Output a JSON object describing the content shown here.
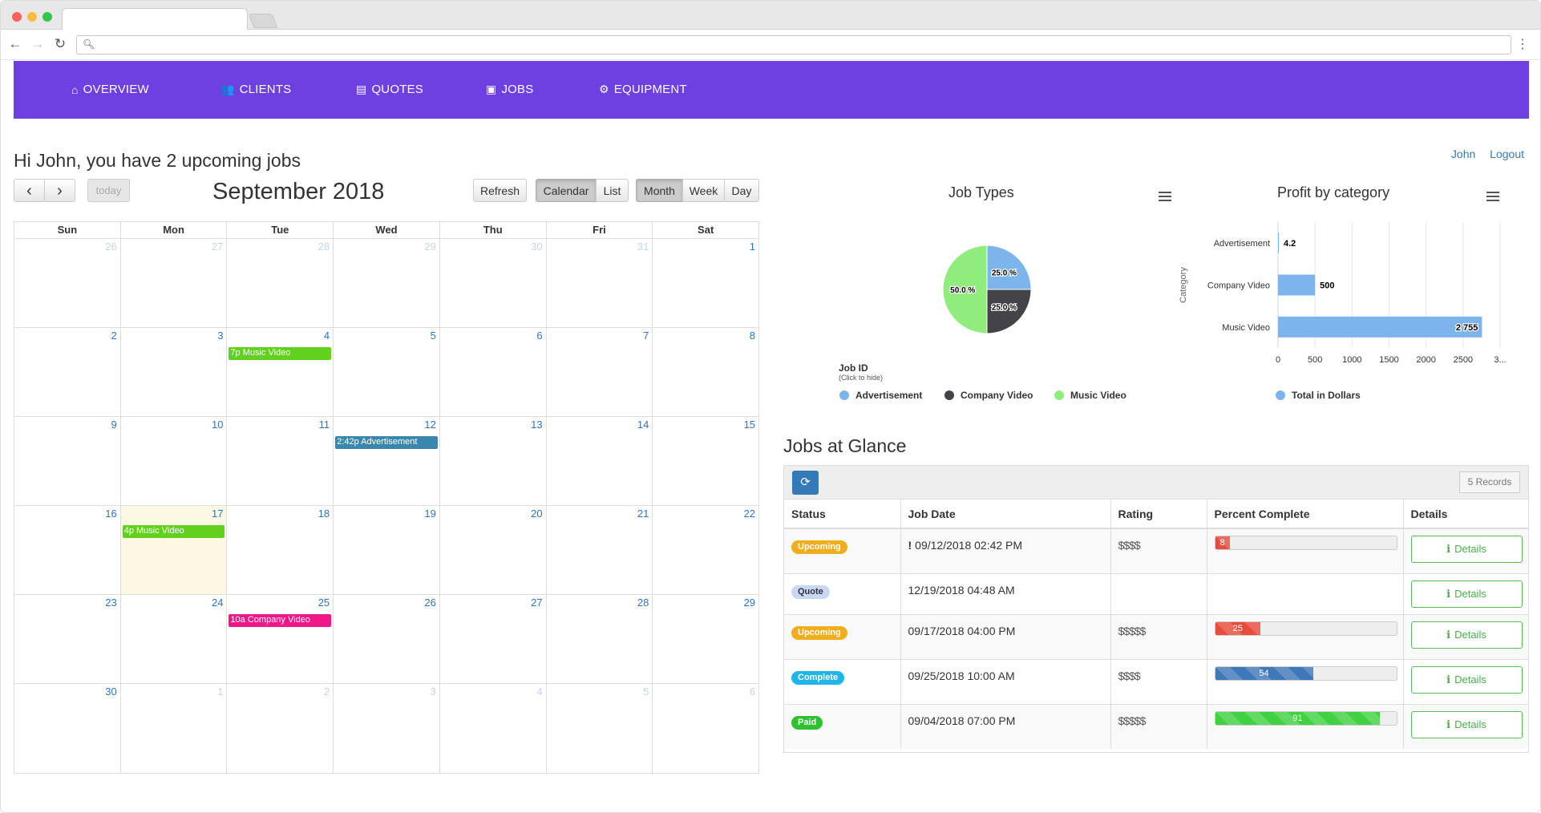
{
  "browser": {
    "url": ""
  },
  "nav": [
    {
      "icon": "home-icon",
      "glyph": "⌂",
      "label": "OVERVIEW"
    },
    {
      "icon": "users-icon",
      "glyph": "👥",
      "label": "CLIENTS"
    },
    {
      "icon": "file-icon",
      "glyph": "▤",
      "label": "QUOTES"
    },
    {
      "icon": "briefcase-icon",
      "glyph": "▣",
      "label": "JOBS"
    },
    {
      "icon": "cogs-icon",
      "glyph": "⚙",
      "label": "EQUIPMENT"
    }
  ],
  "greeting": "Hi John, you have 2 upcoming jobs",
  "user": {
    "name": "John",
    "logout": "Logout"
  },
  "calendar": {
    "prev": "‹",
    "next": "›",
    "today": "today",
    "title": "September 2018",
    "refresh": "Refresh",
    "views1": [
      "Calendar",
      "List"
    ],
    "views2": [
      "Month",
      "Week",
      "Day"
    ],
    "active_view1": "Calendar",
    "active_view2": "Month",
    "weekdays": [
      "Sun",
      "Mon",
      "Tue",
      "Wed",
      "Thu",
      "Fri",
      "Sat"
    ],
    "weeks": [
      [
        {
          "n": "26",
          "other": true
        },
        {
          "n": "27",
          "other": true
        },
        {
          "n": "28",
          "other": true
        },
        {
          "n": "29",
          "other": true
        },
        {
          "n": "30",
          "other": true
        },
        {
          "n": "31",
          "other": true
        },
        {
          "n": "1"
        }
      ],
      [
        {
          "n": "2"
        },
        {
          "n": "3"
        },
        {
          "n": "4",
          "event": "7p Music Video",
          "color": "#62d11e"
        },
        {
          "n": "5"
        },
        {
          "n": "6"
        },
        {
          "n": "7"
        },
        {
          "n": "8"
        }
      ],
      [
        {
          "n": "9"
        },
        {
          "n": "10"
        },
        {
          "n": "11"
        },
        {
          "n": "12",
          "event": "2:42p Advertisement",
          "color": "#3a87ad"
        },
        {
          "n": "13"
        },
        {
          "n": "14"
        },
        {
          "n": "15"
        }
      ],
      [
        {
          "n": "16"
        },
        {
          "n": "17",
          "today": true,
          "event": "4p Music Video",
          "color": "#62d11e"
        },
        {
          "n": "18"
        },
        {
          "n": "19"
        },
        {
          "n": "20"
        },
        {
          "n": "21"
        },
        {
          "n": "22"
        }
      ],
      [
        {
          "n": "23"
        },
        {
          "n": "24"
        },
        {
          "n": "25",
          "event": "10a Company Video",
          "color": "#f01889"
        },
        {
          "n": "26"
        },
        {
          "n": "27"
        },
        {
          "n": "28"
        },
        {
          "n": "29"
        }
      ],
      [
        {
          "n": "30"
        },
        {
          "n": "1",
          "other": true
        },
        {
          "n": "2",
          "other": true
        },
        {
          "n": "3",
          "other": true
        },
        {
          "n": "4",
          "other": true
        },
        {
          "n": "5",
          "other": true
        },
        {
          "n": "6",
          "other": true
        }
      ]
    ]
  },
  "job_types": {
    "title": "Job Types",
    "legend_title": "Job ID",
    "legend_subtitle": "(Click to hide)",
    "chart_data": {
      "type": "pie",
      "slices": [
        {
          "name": "Advertisement",
          "value": 25.0,
          "label": "25.0 %",
          "color": "#7cb5ec"
        },
        {
          "name": "Company Video",
          "value": 25.0,
          "label": "25.0 %",
          "color": "#434348"
        },
        {
          "name": "Music Video",
          "value": 50.0,
          "label": "50.0 %",
          "color": "#90ed7d"
        }
      ]
    }
  },
  "profit": {
    "title": "Profit by category",
    "ylabel": "Category",
    "chart_data": {
      "type": "bar",
      "orientation": "horizontal",
      "categories": [
        "Advertisement",
        "Company Video",
        "Music Video"
      ],
      "values": [
        4.2,
        500,
        2755
      ],
      "data_labels": [
        "4.2",
        "500",
        "2 755"
      ],
      "xticks": [
        "0",
        "500",
        "1000",
        "1500",
        "2000",
        "2500",
        "3..."
      ],
      "xlim": [
        0,
        3000
      ],
      "series": [
        {
          "name": "Total in Dollars",
          "color": "#7cb5ec"
        }
      ]
    }
  },
  "jobs": {
    "title": "Jobs at Glance",
    "records": "5 Records",
    "columns": [
      "Status",
      "Job Date",
      "Rating",
      "Percent Complete",
      "Details"
    ],
    "details_label": "Details",
    "rows": [
      {
        "status": "Upcoming",
        "status_color": "#f0ad1e",
        "date": "09/12/2018 02:42 PM",
        "late": true,
        "rating": "$$$$",
        "progress": 8,
        "progress_label": "8",
        "progress_color": "#e74c3c",
        "has_progress": true
      },
      {
        "status": "Quote",
        "status_color": "#c9d7f5",
        "date": "12/19/2018 04:48 AM",
        "late": false,
        "rating": "",
        "progress": 0,
        "progress_label": "",
        "progress_color": "",
        "has_progress": false
      },
      {
        "status": "Upcoming",
        "status_color": "#f0ad1e",
        "date": "09/17/2018 04:00 PM",
        "late": false,
        "rating": "$$$$$",
        "progress": 25,
        "progress_label": "25",
        "progress_color": "#e74c3c",
        "has_progress": true
      },
      {
        "status": "Complete",
        "status_color": "#1fb5e8",
        "date": "09/25/2018 10:00 AM",
        "late": false,
        "rating": "$$$$",
        "progress": 54,
        "progress_label": "54",
        "progress_color": "#3f78b8",
        "has_progress": true
      },
      {
        "status": "Paid",
        "status_color": "#2fc12f",
        "date": "09/04/2018 07:00 PM",
        "late": false,
        "rating": "$$$$$",
        "progress": 91,
        "progress_label": "91",
        "progress_color": "#3fd13f",
        "has_progress": true
      }
    ]
  }
}
